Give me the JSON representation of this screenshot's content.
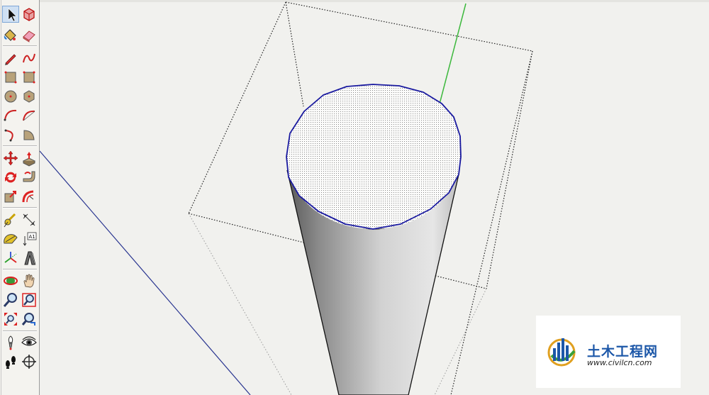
{
  "toolbar": {
    "tools": [
      {
        "name": "select-tool",
        "icon": "arrow-cursor-icon",
        "selected": true
      },
      {
        "name": "component-tool",
        "icon": "component-box-icon"
      },
      {
        "name": "paint-bucket-tool",
        "icon": "paint-bucket-icon"
      },
      {
        "name": "eraser-tool",
        "icon": "eraser-icon"
      },
      {
        "name": "line-tool",
        "icon": "pencil-icon"
      },
      {
        "name": "freehand-tool",
        "icon": "freehand-curve-icon"
      },
      {
        "name": "rectangle-tool",
        "icon": "rectangle-icon"
      },
      {
        "name": "rotated-rectangle-tool",
        "icon": "rotated-rectangle-icon"
      },
      {
        "name": "circle-tool",
        "icon": "circle-icon"
      },
      {
        "name": "polygon-tool",
        "icon": "polygon-icon"
      },
      {
        "name": "arc-tool",
        "icon": "arc-icon"
      },
      {
        "name": "two-point-arc-tool",
        "icon": "two-point-arc-icon"
      },
      {
        "name": "three-point-arc-tool",
        "icon": "three-point-arc-icon"
      },
      {
        "name": "pie-tool",
        "icon": "pie-icon"
      },
      {
        "name": "move-tool",
        "icon": "move-arrows-icon"
      },
      {
        "name": "push-pull-tool",
        "icon": "push-pull-icon"
      },
      {
        "name": "rotate-tool",
        "icon": "rotate-icon"
      },
      {
        "name": "follow-me-tool",
        "icon": "follow-me-icon"
      },
      {
        "name": "scale-tool",
        "icon": "scale-icon"
      },
      {
        "name": "offset-tool",
        "icon": "offset-icon"
      },
      {
        "name": "tape-measure-tool",
        "icon": "tape-measure-icon"
      },
      {
        "name": "dimension-tool",
        "icon": "dimension-icon"
      },
      {
        "name": "protractor-tool",
        "icon": "protractor-icon"
      },
      {
        "name": "text-tool",
        "icon": "text-label-icon",
        "label": "A1"
      },
      {
        "name": "axes-tool",
        "icon": "axes-icon"
      },
      {
        "name": "3d-text-tool",
        "icon": "3d-text-icon"
      },
      {
        "name": "orbit-tool",
        "icon": "orbit-icon"
      },
      {
        "name": "pan-tool",
        "icon": "hand-icon"
      },
      {
        "name": "zoom-tool",
        "icon": "magnifier-icon"
      },
      {
        "name": "zoom-window-tool",
        "icon": "zoom-window-icon"
      },
      {
        "name": "zoom-extents-tool",
        "icon": "zoom-extents-icon"
      },
      {
        "name": "previous-view-tool",
        "icon": "previous-view-icon"
      },
      {
        "name": "position-camera-tool",
        "icon": "position-camera-icon"
      },
      {
        "name": "look-around-tool",
        "icon": "eye-icon"
      },
      {
        "name": "walk-tool",
        "icon": "footprints-icon"
      },
      {
        "name": "section-plane-tool",
        "icon": "section-plane-icon"
      }
    ]
  },
  "colors": {
    "background": "#f1f1ee",
    "green_axis": "#3cb83c",
    "blue_axis": "#27338f",
    "edge_highlight": "#1a1aa0",
    "brand": "#1c57a8"
  },
  "watermark": {
    "name": "土木工程网",
    "url": "www.civilcn.com"
  }
}
